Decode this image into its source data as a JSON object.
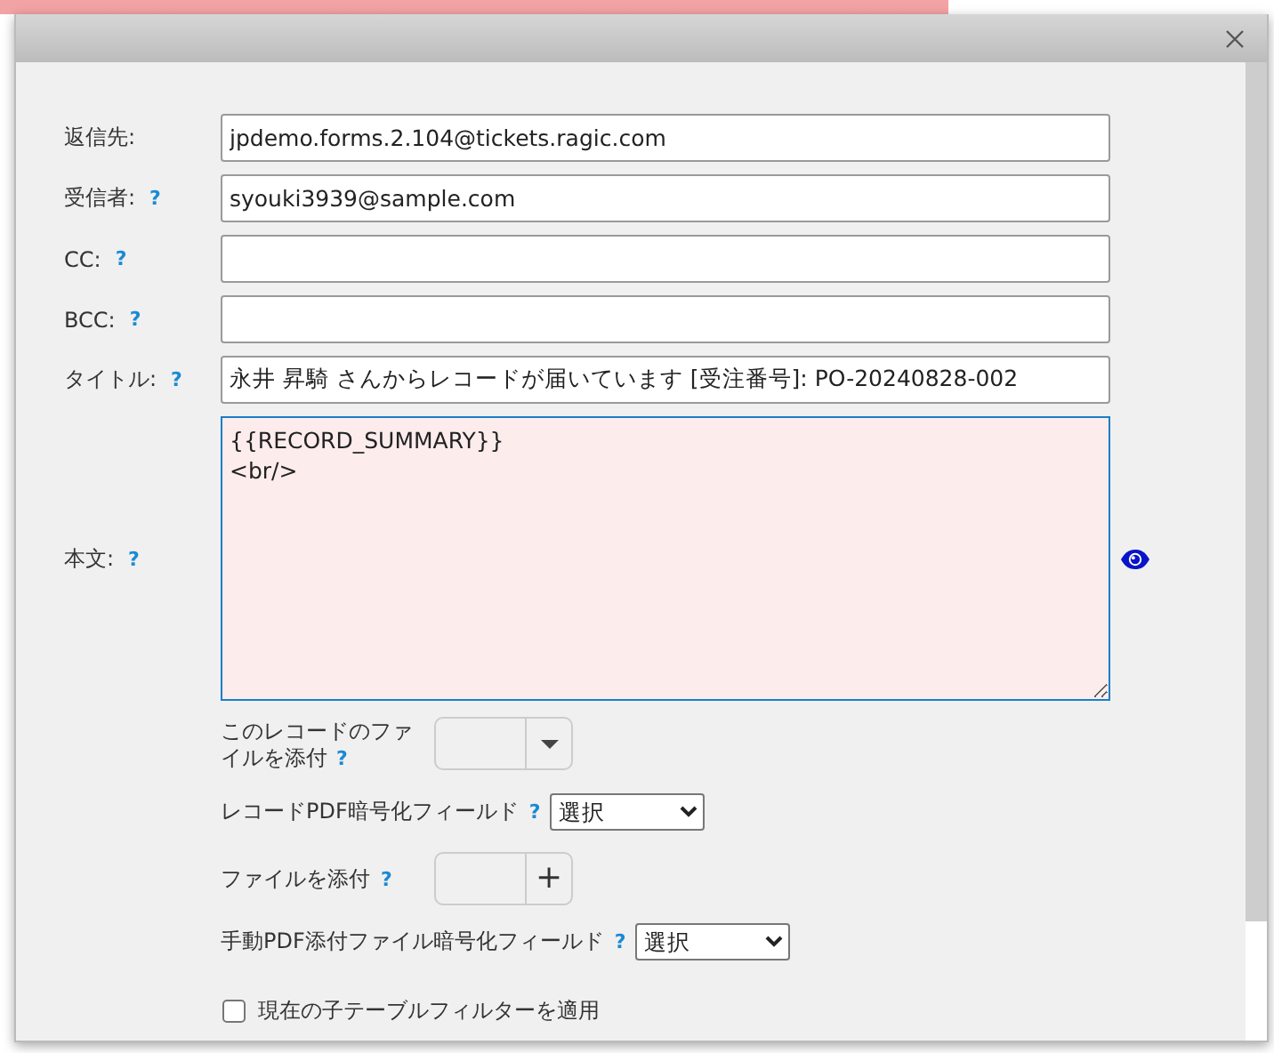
{
  "fields": [
    {
      "label": "返信先:",
      "value": "jpdemo.forms.2.104@tickets.ragic.com"
    },
    {
      "label": "受信者:",
      "help": "?",
      "value": "syouki3939@sample.com"
    },
    {
      "label": "CC:",
      "help": "?"
    },
    {
      "label": "BCC:",
      "help": "?"
    },
    {
      "label": "タイトル:",
      "help": "?",
      "value": "永井 昇騎 さんからレコードが届いています [受注番号]: PO-20240828-002"
    }
  ],
  "body": {
    "label": "本文:",
    "help": "?",
    "value": "{{RECORD_SUMMARY}}\n<br/>"
  },
  "options": [
    {
      "kind": "dropdown",
      "label_lines": [
        "このレコードのファ",
        "イルを添付"
      ],
      "help": "?"
    },
    {
      "kind": "select",
      "label": "レコードPDF暗号化フィールド",
      "help": "?",
      "value": "選択"
    },
    {
      "kind": "upload",
      "label": "ファイルを添付",
      "help": "?",
      "button": "+"
    },
    {
      "kind": "select",
      "label": "手動PDF添付ファイル暗号化フィールド",
      "help": "?",
      "value": "選択"
    },
    {
      "kind": "checkbox",
      "label": "現在の子テーブルフィルターを適用",
      "checked": false
    }
  ]
}
